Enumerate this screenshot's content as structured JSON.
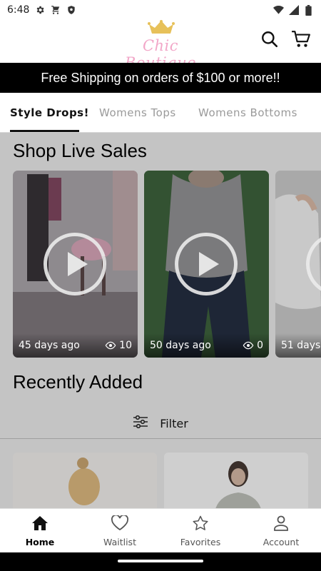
{
  "status_bar": {
    "time": "6:48",
    "left_icons": [
      "gear-icon",
      "cart-icon",
      "shield-icon"
    ],
    "right_icons": [
      "wifi-icon",
      "signal-icon",
      "battery-icon"
    ]
  },
  "header": {
    "logo_text": "Chic Boutique",
    "logo_color": "#f2a7c8",
    "crown_color": "#e7c15a",
    "search_icon": "search-icon",
    "cart_icon": "cart-icon"
  },
  "promo_banner": {
    "text": "Free Shipping on orders of $100 or more!!"
  },
  "tabs": [
    {
      "label": "Style Drops!",
      "active": true
    },
    {
      "label": "Womens Tops",
      "active": false
    },
    {
      "label": "Womens Bottoms",
      "active": false
    }
  ],
  "live_sales": {
    "title": "Shop Live Sales",
    "videos": [
      {
        "age": "45 days ago",
        "views": "10"
      },
      {
        "age": "50 days ago",
        "views": "0"
      },
      {
        "age": "51 days",
        "views": ""
      }
    ]
  },
  "recently_added": {
    "title": "Recently Added",
    "filter_label": "Filter"
  },
  "bottom_nav": [
    {
      "label": "Home",
      "icon": "home-icon",
      "active": true
    },
    {
      "label": "Waitlist",
      "icon": "heart-icon",
      "active": false
    },
    {
      "label": "Favorites",
      "icon": "star-icon",
      "active": false
    },
    {
      "label": "Account",
      "icon": "account-icon",
      "active": false
    }
  ]
}
